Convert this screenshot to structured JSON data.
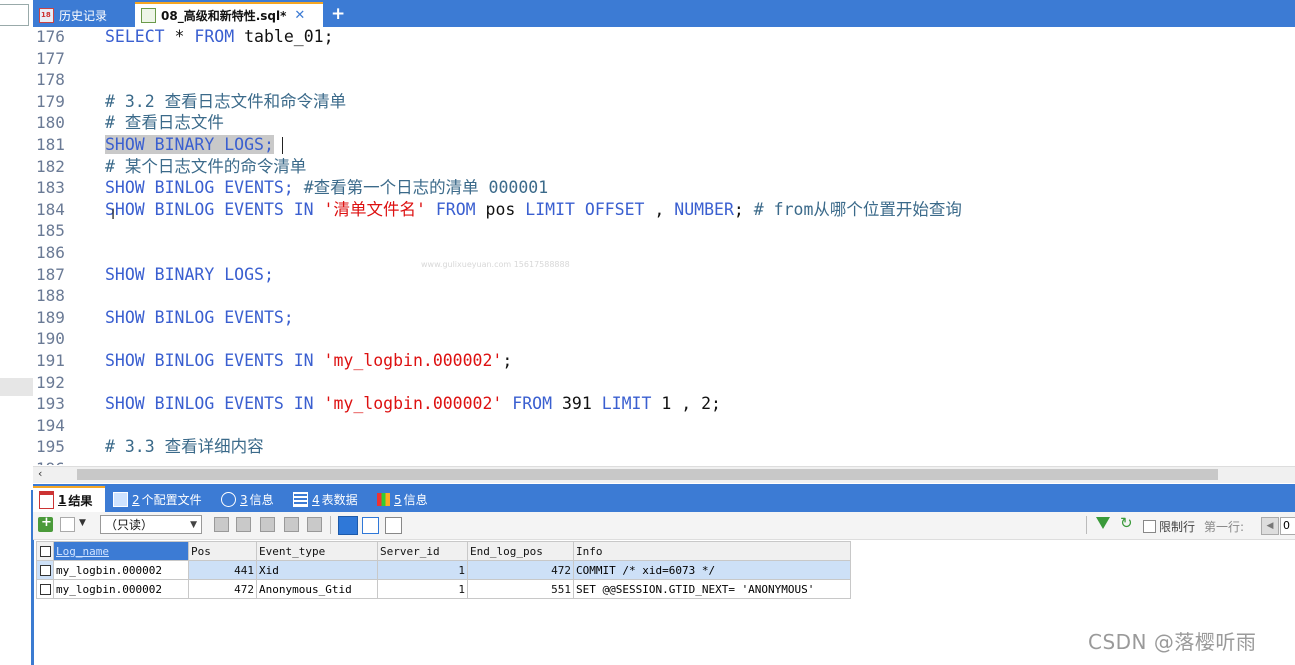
{
  "tabs": {
    "history_label": "历史记录",
    "sql_tab_label": "08_高级和新特性.sql*",
    "close_glyph": "✕",
    "add_glyph": "+"
  },
  "editor": {
    "lines": [
      {
        "n": "176",
        "tokens": [
          [
            "kw",
            "SELECT "
          ],
          [
            "plain",
            "* "
          ],
          [
            "kw",
            "FROM "
          ],
          [
            "plain",
            "table_01;"
          ]
        ]
      },
      {
        "n": "177",
        "tokens": []
      },
      {
        "n": "178",
        "tokens": []
      },
      {
        "n": "179",
        "tokens": [
          [
            "cm",
            "# 3.2 查看日志文件和命令清单"
          ]
        ]
      },
      {
        "n": "180",
        "tokens": [
          [
            "cm",
            "# 查看日志文件"
          ]
        ]
      },
      {
        "n": "181",
        "tokens": [
          [
            "sel-kw",
            "SHOW BINARY LOGS;"
          ]
        ],
        "cursor": true
      },
      {
        "n": "182",
        "tokens": [
          [
            "cm",
            "# 某个日志文件的命令清单"
          ]
        ]
      },
      {
        "n": "183",
        "tokens": [
          [
            "kw",
            "SHOW BINLOG EVENTS; "
          ],
          [
            "cm",
            "#查看第一个日志的清单 000001"
          ]
        ]
      },
      {
        "n": "184",
        "tokens": [
          [
            "kw",
            "SHOW BINLOG EVENTS IN "
          ],
          [
            "str",
            "'清单文件名' "
          ],
          [
            "kw",
            "FROM "
          ],
          [
            "plain",
            "pos "
          ],
          [
            "kw",
            "LIMIT OFFSET "
          ],
          [
            "plain",
            ", "
          ],
          [
            "kw",
            "NUMBER"
          ],
          [
            "plain",
            "; "
          ],
          [
            "cm",
            "# from从哪个位置开始查询"
          ]
        ]
      },
      {
        "n": "185",
        "tokens": []
      },
      {
        "n": "186",
        "tokens": []
      },
      {
        "n": "187",
        "tokens": [
          [
            "kw",
            "SHOW BINARY LOGS;"
          ]
        ]
      },
      {
        "n": "188",
        "tokens": []
      },
      {
        "n": "189",
        "tokens": [
          [
            "kw",
            "SHOW BINLOG EVENTS;"
          ]
        ]
      },
      {
        "n": "190",
        "tokens": []
      },
      {
        "n": "191",
        "tokens": [
          [
            "kw",
            "SHOW BINLOG EVENTS IN "
          ],
          [
            "str",
            "'my_logbin.000002'"
          ],
          [
            "plain",
            ";"
          ]
        ]
      },
      {
        "n": "192",
        "tokens": []
      },
      {
        "n": "193",
        "tokens": [
          [
            "kw",
            "SHOW BINLOG EVENTS IN "
          ],
          [
            "str",
            "'my_logbin.000002' "
          ],
          [
            "kw",
            "FROM "
          ],
          [
            "plain",
            "391 "
          ],
          [
            "kw",
            "LIMIT "
          ],
          [
            "plain",
            "1 , 2;"
          ]
        ]
      },
      {
        "n": "194",
        "tokens": []
      },
      {
        "n": "195",
        "tokens": [
          [
            "cm",
            "# 3.3 查看详细内容"
          ]
        ]
      },
      {
        "n": "196",
        "tokens": []
      }
    ],
    "faint_watermark": "www.gulixueyuan.com 15617588888"
  },
  "result_tabs": [
    {
      "num": "1",
      "label": " 结果"
    },
    {
      "num": "2",
      "label": " 个配置文件"
    },
    {
      "num": "3",
      "label": " 信息"
    },
    {
      "num": "4",
      "label": " 表数据"
    },
    {
      "num": "5",
      "label": " 信息"
    }
  ],
  "toolbar": {
    "mode_select": "（只读）",
    "limit_rows_label": "限制行",
    "first_row_label": "第一行:",
    "first_row_value": "0"
  },
  "grid": {
    "columns": [
      "Log_name",
      "Pos",
      "Event_type",
      "Server_id",
      "End_log_pos",
      "Info"
    ],
    "rows": [
      [
        "my_logbin.000002",
        "441",
        "Xid",
        "1",
        "472",
        "COMMIT /* xid=6073 */"
      ],
      [
        "my_logbin.000002",
        "472",
        "Anonymous_Gtid",
        "1",
        "551",
        "SET @@SESSION.GTID_NEXT= 'ANONYMOUS'"
      ]
    ]
  },
  "footer": {
    "watermark": "CSDN @落樱听雨"
  }
}
